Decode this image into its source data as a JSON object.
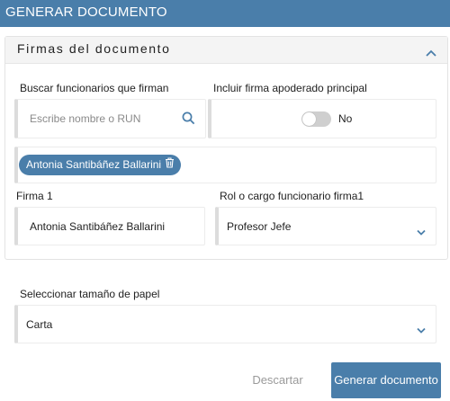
{
  "dialog": {
    "title": "GENERAR DOCUMENTO"
  },
  "firmas": {
    "title": "Firmas del documento",
    "buscar_label": "Buscar funcionarios que firman",
    "buscar_placeholder": "Escribe nombre o RUN",
    "apoderado_label": "Incluir firma apoderado principal",
    "apoderado_toggle_text": "No",
    "apoderado_enabled": false,
    "selected_chip": "Antonia Santibáñez Ballarini",
    "firma1_label": "Firma 1",
    "firma1_value": "Antonia Santibáñez Ballarini",
    "rol1_label": "Rol o cargo funcionario firma1",
    "rol1_value": "Profesor Jefe"
  },
  "papel": {
    "label": "Seleccionar tamaño de papel",
    "value": "Carta"
  },
  "actions": {
    "discard": "Descartar",
    "generate": "Generar documento"
  },
  "colors": {
    "primary": "#4a7eaa",
    "secondary_text": "#9a9a9a"
  }
}
